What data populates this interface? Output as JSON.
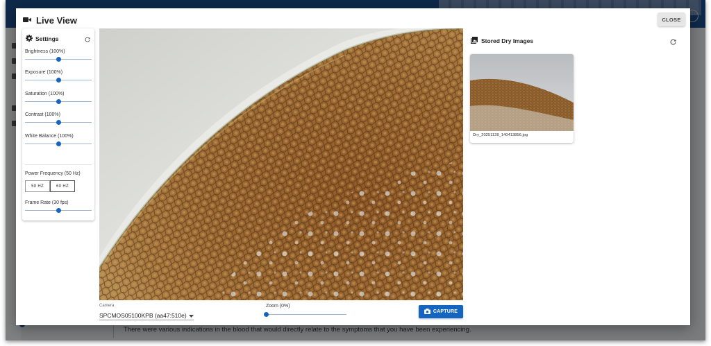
{
  "dialog": {
    "title": "Live View",
    "close_label": "CLOSE"
  },
  "settings": {
    "title": "Settings",
    "sliders": [
      {
        "label": "Brightness (100%)",
        "value": 0.5
      },
      {
        "label": "Exposure (100%)",
        "value": 0.5
      },
      {
        "label": "Saturation (100%)",
        "value": 0.5
      },
      {
        "label": "Contrast (100%)",
        "value": 0.5
      },
      {
        "label": "White Balance (100%)",
        "value": 0.5
      }
    ],
    "power_frequency": {
      "label": "Power Frequency (50 Hz)",
      "options": [
        "50 HZ",
        "60 HZ"
      ],
      "selected": "50 HZ"
    },
    "frame_rate": {
      "label": "Frame Rate (30 fps)",
      "value": 0.5
    }
  },
  "controls": {
    "camera_label": "Camera",
    "camera_value": "SPCMOS05100KPB (aa47:510e)",
    "zoom_label": "Zoom (0%)",
    "zoom_value": 0,
    "capture_label": "CAPTURE"
  },
  "stored": {
    "title": "Stored Dry Images",
    "images": [
      {
        "filename": "Dry_20251128_140413856.jpg"
      }
    ]
  },
  "background": {
    "text": "There were various indications in the blood that would directly relate to the symptoms that you have been experiencing."
  },
  "colors": {
    "accent": "#1565c0",
    "topbar": "#1e4f8f"
  }
}
